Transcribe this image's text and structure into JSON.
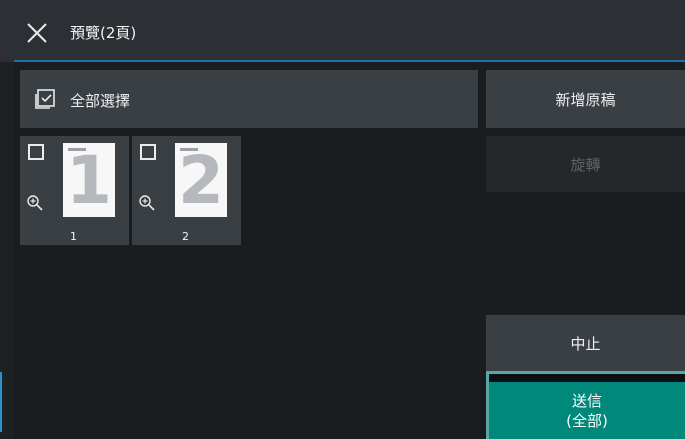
{
  "header": {
    "title": "預覽(2頁)",
    "close_icon": "close-icon"
  },
  "selection": {
    "select_all_label": "全部選擇",
    "icon": "checkbox-checked-icon"
  },
  "thumbnails": [
    {
      "page_number": "1",
      "digit": "1",
      "checked": false
    },
    {
      "page_number": "2",
      "digit": "2",
      "checked": false
    }
  ],
  "sidebar": {
    "add_original_label": "新增原稿",
    "rotate_label": "旋轉",
    "stop_label": "中止",
    "send_label_line1": "送信",
    "send_label_line2": "(全部)"
  },
  "colors": {
    "titlebar": "#2c3034",
    "panel": "#3a3f44",
    "background": "#1e2124",
    "send_button": "#00897b",
    "accent_line": "#1f6fa8"
  }
}
